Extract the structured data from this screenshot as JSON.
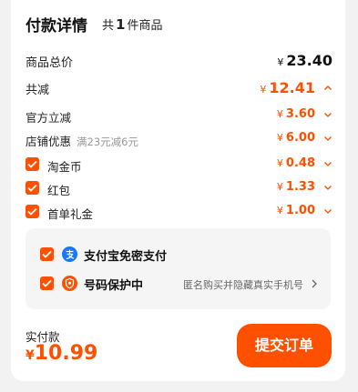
{
  "header": {
    "title": "付款详情",
    "count_prefix": "共",
    "count": "1",
    "count_suffix": "件商品"
  },
  "rows": {
    "total_goods": {
      "label": "商品总价",
      "currency": "¥",
      "value": "23.40"
    },
    "discount": {
      "label": "共减",
      "currency": "¥",
      "value": "12.41"
    },
    "official": {
      "label": "官方立减",
      "currency": "¥",
      "value": "3.60"
    },
    "store": {
      "label": "店铺优惠",
      "sub": "满23元减6元",
      "currency": "¥",
      "value": "6.00"
    },
    "taojinbi": {
      "label": "淘金币",
      "currency": "¥",
      "value": "0.48"
    },
    "hongbao": {
      "label": "红包",
      "currency": "¥",
      "value": "1.33"
    },
    "first_gift": {
      "label": "首单礼金",
      "currency": "¥",
      "value": "1.00"
    }
  },
  "options": {
    "alipay": {
      "label": "支付宝免密支付"
    },
    "privacy": {
      "label": "号码保护中",
      "hint": "匿名购买并隐藏真实手机号"
    }
  },
  "footer": {
    "total_label": "实付款",
    "currency": "¥",
    "total": "10.99",
    "submit_label": "提交订单"
  },
  "colors": {
    "accent": "#ff5000",
    "alipay_blue": "#1677ff",
    "panel_bg": "#f5f5f5"
  }
}
